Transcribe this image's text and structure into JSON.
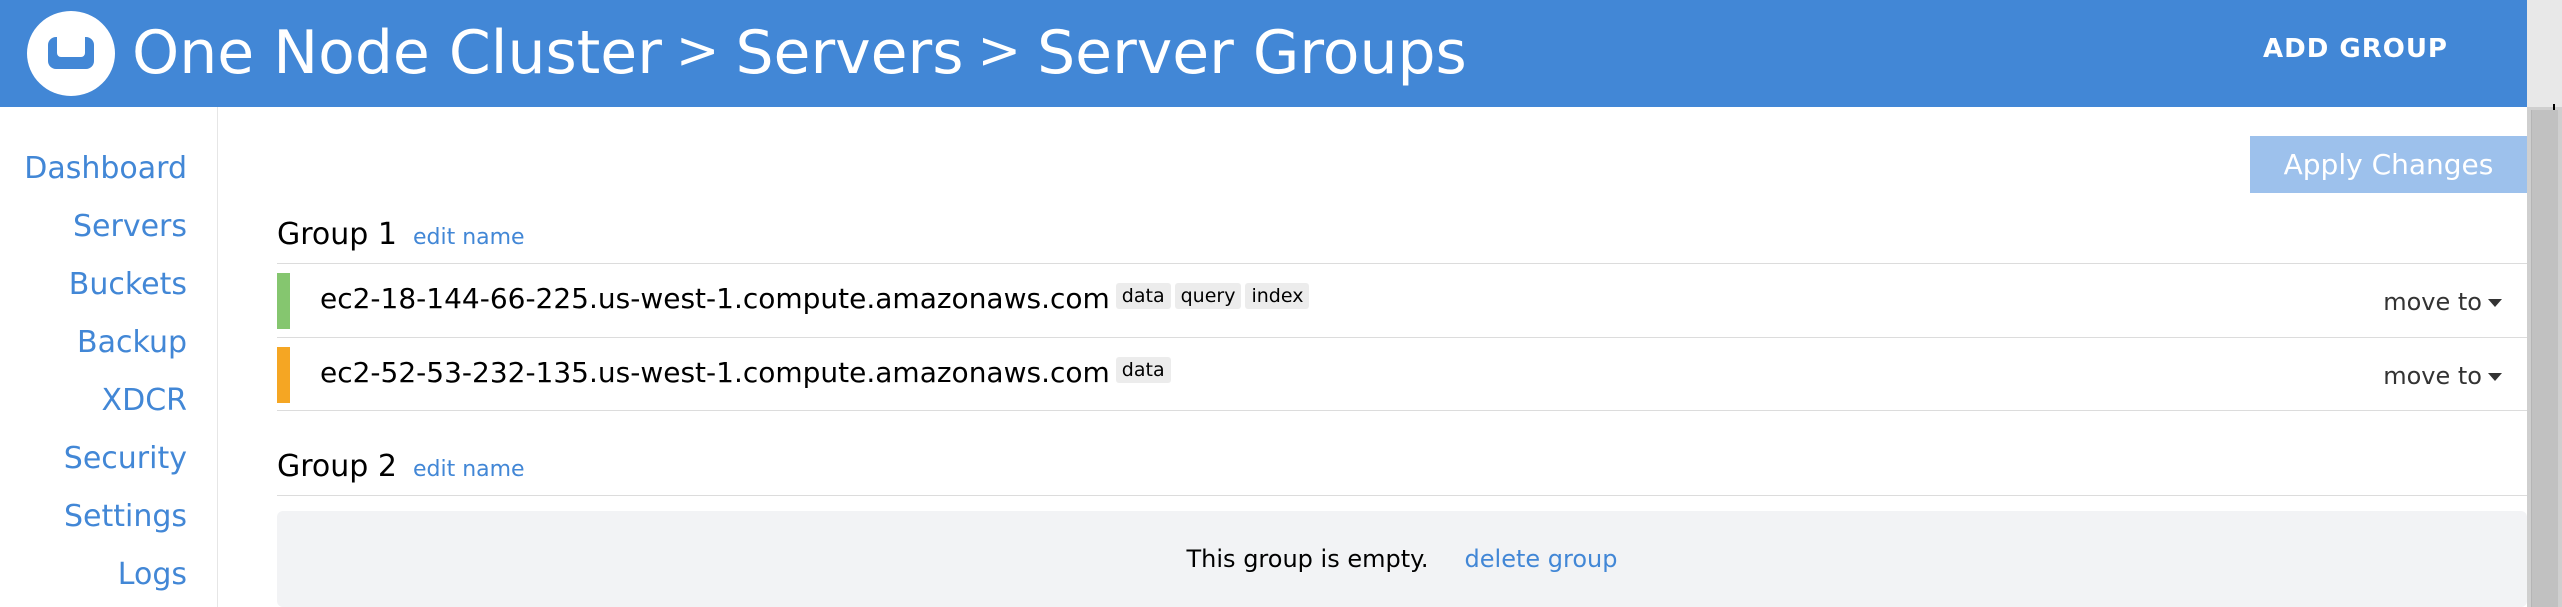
{
  "header": {
    "logo_icon": "couchbase-logo-icon",
    "breadcrumbs": [
      "One Node Cluster",
      "Servers",
      "Server Groups"
    ],
    "separator": ">",
    "add_group_label": "ADD GROUP",
    "background_color": "#4287d6"
  },
  "sidebar": {
    "items": [
      {
        "label": "Dashboard"
      },
      {
        "label": "Servers"
      },
      {
        "label": "Buckets"
      },
      {
        "label": "Backup"
      },
      {
        "label": "XDCR"
      },
      {
        "label": "Security"
      },
      {
        "label": "Settings"
      },
      {
        "label": "Logs"
      }
    ]
  },
  "main": {
    "apply_changes_label": "Apply Changes",
    "groups": [
      {
        "name": "Group 1",
        "edit_label": "edit name",
        "servers": [
          {
            "hostname": "ec2-18-144-66-225.us-west-1.compute.amazonaws.com",
            "services": [
              "data",
              "query",
              "index"
            ],
            "status_color": "#85c66f",
            "move_label": "move to"
          },
          {
            "hostname": "ec2-52-53-232-135.us-west-1.compute.amazonaws.com",
            "services": [
              "data"
            ],
            "status_color": "#f5a623",
            "move_label": "move to"
          }
        ]
      },
      {
        "name": "Group 2",
        "edit_label": "edit name",
        "empty_text": "This group is empty.",
        "delete_label": "delete group"
      }
    ]
  }
}
